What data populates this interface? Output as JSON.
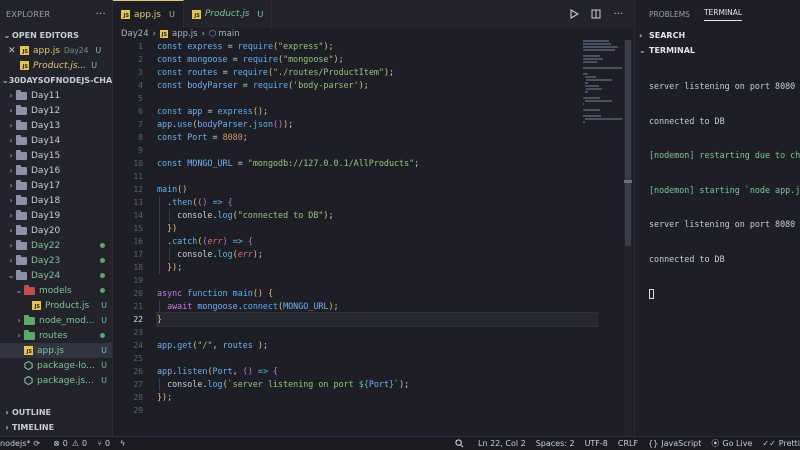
{
  "explorer": {
    "title": "EXPLORER",
    "more": "···",
    "open_editors_label": "OPEN EDITORS",
    "open_editors": [
      {
        "name": "app.js",
        "path": "Day24",
        "status": "U",
        "close": "✕"
      },
      {
        "name": "Product.js...",
        "path": "",
        "status": "U"
      }
    ],
    "project_label": "30DAYSOFNODEJS-CHALLE...",
    "tree": [
      {
        "label": "Day11",
        "type": "folder"
      },
      {
        "label": "Day12",
        "type": "folder"
      },
      {
        "label": "Day13",
        "type": "folder"
      },
      {
        "label": "Day14",
        "type": "folder"
      },
      {
        "label": "Day15",
        "type": "folder"
      },
      {
        "label": "Day16",
        "type": "folder"
      },
      {
        "label": "Day17",
        "type": "folder"
      },
      {
        "label": "Day18",
        "type": "folder"
      },
      {
        "label": "Day19",
        "type": "folder"
      },
      {
        "label": "Day20",
        "type": "folder"
      },
      {
        "label": "Day22",
        "type": "folder"
      },
      {
        "label": "Day23",
        "type": "folder"
      },
      {
        "label": "Day24",
        "type": "folder-open"
      },
      {
        "label": "models",
        "type": "folder-open"
      },
      {
        "label": "Product.js",
        "type": "js",
        "badge": "U"
      },
      {
        "label": "node_mod...",
        "type": "folder",
        "badge": "U"
      },
      {
        "label": "routes",
        "type": "folder"
      },
      {
        "label": "app.js",
        "type": "js",
        "badge": "U"
      },
      {
        "label": "package-lo...",
        "type": "node",
        "badge": "U"
      },
      {
        "label": "package.json",
        "type": "node",
        "badge": "U"
      }
    ],
    "outline_label": "OUTLINE",
    "timeline_label": "TIMELINE"
  },
  "tabs": [
    {
      "label": "app.js",
      "status": "U",
      "active": true
    },
    {
      "label": "Product.js",
      "status": "U",
      "active": false
    }
  ],
  "breadcrumb": {
    "folder": "Day24",
    "file": "app.js",
    "symbol": "main"
  },
  "editor": {
    "current_line": 22,
    "lines": [
      "const express = require(\"express\");",
      "const mongoose = require(\"mongoose\");",
      "const routes = require(\"./routes/ProductItem\");",
      "const bodyParser = require('body-parser');",
      "",
      "const app = express();",
      "app.use(bodyParser.json());",
      "const Port = 8080;",
      "",
      "const MONGO_URL = \"mongodb://127.0.0.1/AllProducts\";",
      "",
      "main()",
      "  .then(() => {",
      "    console.log(\"connected to DB\");",
      "  })",
      "  .catch((err) => {",
      "    console.log(err);",
      "  });",
      "",
      "async function main() {",
      "  await mongoose.connect(MONGO_URL);",
      "}",
      "",
      "app.get(\"/\", routes );",
      "",
      "app.listen(Port, () => {",
      "  console.log(`server listening on port ${Port}`);",
      "});",
      ""
    ]
  },
  "panel": {
    "tabs": [
      "PROBLEMS",
      "TERMINAL"
    ],
    "active_tab": "TERMINAL",
    "search_label": "SEARCH",
    "terminal_label": "TERMINAL",
    "terminal_lines": [
      {
        "text": "server listening on port 8080",
        "color": "default"
      },
      {
        "text": "connected to DB",
        "color": "default"
      },
      {
        "text": "[nodemon] restarting due to ch",
        "color": "green"
      },
      {
        "text": "[nodemon] starting `node app.j",
        "color": "green"
      },
      {
        "text": "server listening on port 8080",
        "color": "default"
      },
      {
        "text": "connected to DB",
        "color": "default"
      }
    ]
  },
  "statusbar": {
    "branch": "nodejs*",
    "errors": "0",
    "warnings": "0",
    "ports": "0",
    "position": "Ln 22, Col 2",
    "spaces": "Spaces: 2",
    "encoding": "UTF-8",
    "eol": "CRLF",
    "language": "JavaScript",
    "golive": "Go Live",
    "prettier": "Pretti"
  },
  "colors": {
    "background": "#1e1f26",
    "sidebar": "#22232b",
    "accent_tab": "#e3c96e",
    "untracked": "#7ec699",
    "string": "#98c379",
    "keyword": "#c678dd",
    "function": "#61afef",
    "number": "#d19a66"
  }
}
